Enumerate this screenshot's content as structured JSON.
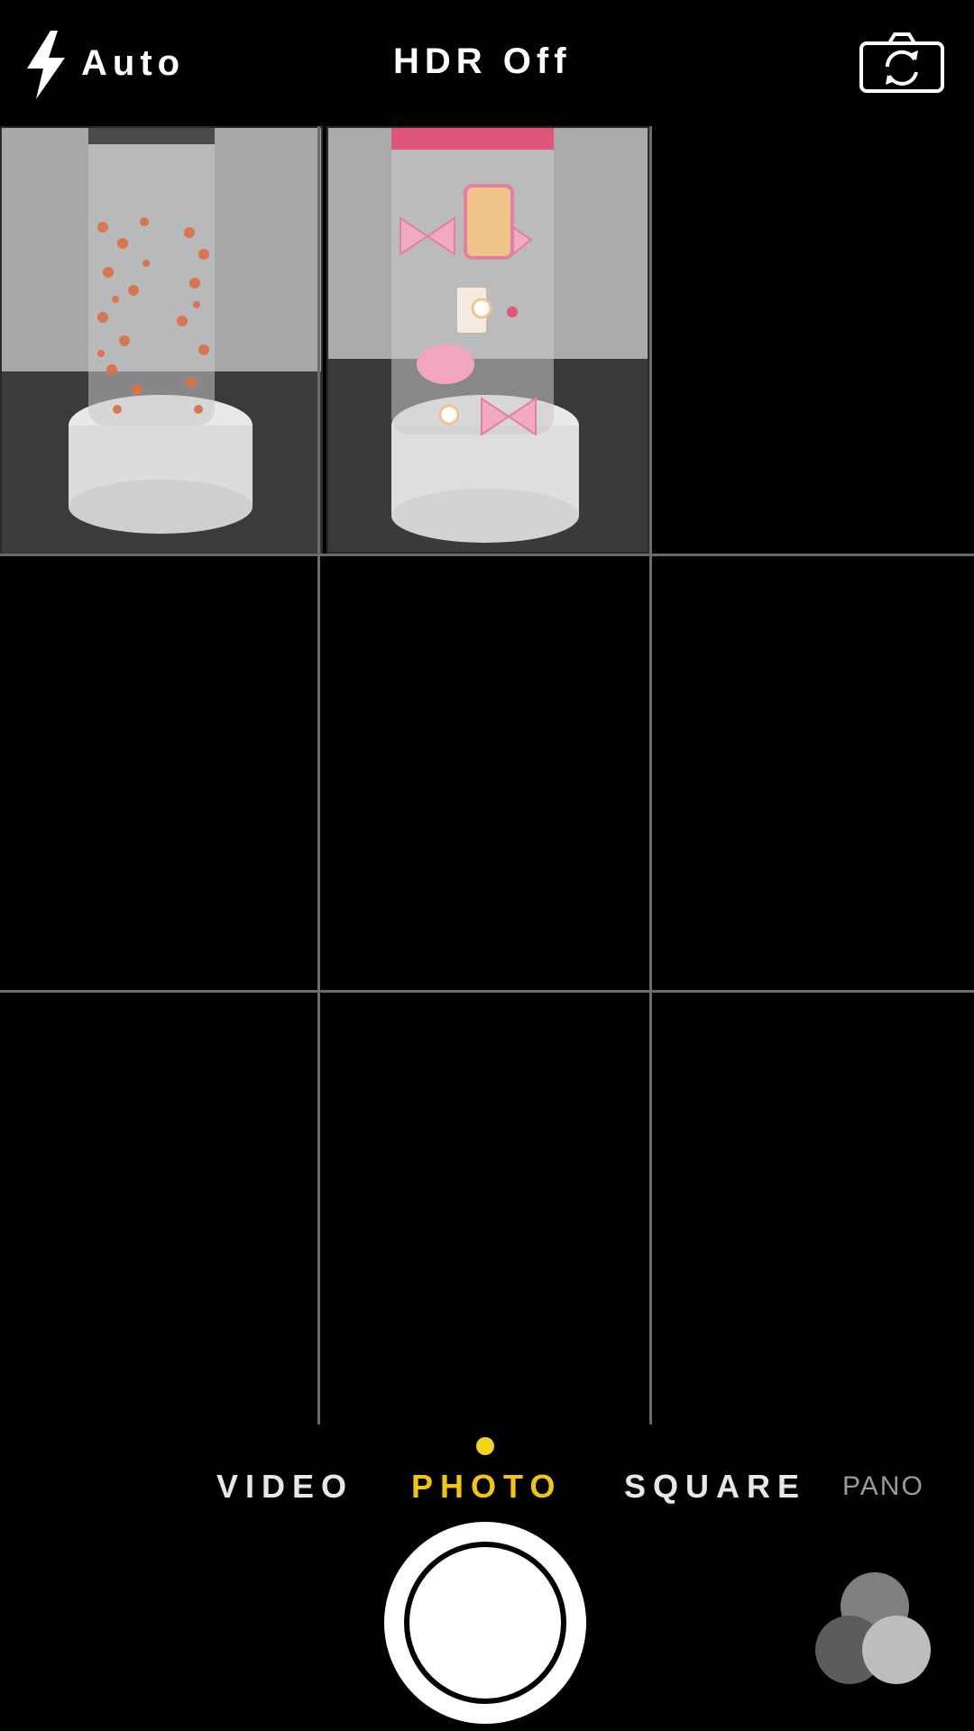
{
  "top_bar": {
    "flash_icon": "lightning-bolt-icon",
    "flash_label": "Auto",
    "hdr_label": "HDR Off",
    "flip_icon": "camera-flip-icon"
  },
  "viewfinder": {
    "grid": "3x3",
    "thumbnails": [
      {
        "subject": "clear glass can with orange leopard-heart print on white stand"
      },
      {
        "subject": "clear glass can with pink bows, cups and flowers print on white stand"
      }
    ]
  },
  "modes": {
    "items": [
      "VIDEO",
      "PHOTO",
      "SQUARE",
      "PANO"
    ],
    "selected": "PHOTO",
    "accent_color": "#f1c40f"
  },
  "controls": {
    "shutter_icon": "shutter-button-icon",
    "filters_icon": "filters-icon"
  }
}
